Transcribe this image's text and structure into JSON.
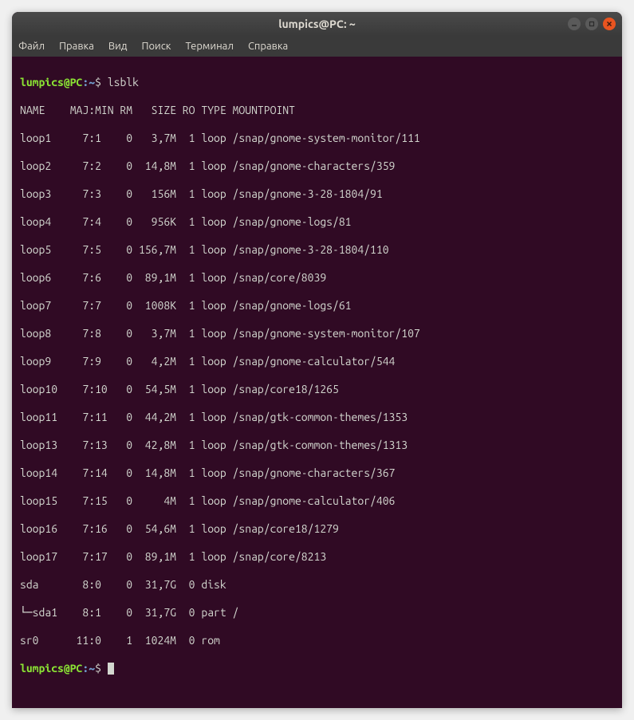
{
  "window": {
    "title": "lumpics@PC: ~"
  },
  "menu": {
    "file": "Файл",
    "edit": "Правка",
    "view": "Вид",
    "search": "Поиск",
    "terminal": "Терминал",
    "help": "Справка"
  },
  "prompt": {
    "user_host": "lumpics@PC",
    "colon": ":",
    "path": "~",
    "symbol": "$"
  },
  "command": "lsblk",
  "header": "NAME    MAJ:MIN RM   SIZE RO TYPE MOUNTPOINT",
  "rows": [
    "loop1     7:1    0   3,7M  1 loop /snap/gnome-system-monitor/111",
    "loop2     7:2    0  14,8M  1 loop /snap/gnome-characters/359",
    "loop3     7:3    0   156M  1 loop /snap/gnome-3-28-1804/91",
    "loop4     7:4    0   956K  1 loop /snap/gnome-logs/81",
    "loop5     7:5    0 156,7M  1 loop /snap/gnome-3-28-1804/110",
    "loop6     7:6    0  89,1M  1 loop /snap/core/8039",
    "loop7     7:7    0  1008K  1 loop /snap/gnome-logs/61",
    "loop8     7:8    0   3,7M  1 loop /snap/gnome-system-monitor/107",
    "loop9     7:9    0   4,2M  1 loop /snap/gnome-calculator/544",
    "loop10    7:10   0  54,5M  1 loop /snap/core18/1265",
    "loop11    7:11   0  44,2M  1 loop /snap/gtk-common-themes/1353",
    "loop13    7:13   0  42,8M  1 loop /snap/gtk-common-themes/1313",
    "loop14    7:14   0  14,8M  1 loop /snap/gnome-characters/367",
    "loop15    7:15   0     4M  1 loop /snap/gnome-calculator/406",
    "loop16    7:16   0  54,6M  1 loop /snap/core18/1279",
    "loop17    7:17   0  89,1M  1 loop /snap/core/8213",
    "sda       8:0    0  31,7G  0 disk ",
    "└─sda1    8:1    0  31,7G  0 part /",
    "sr0      11:0    1  1024M  0 rom  "
  ]
}
